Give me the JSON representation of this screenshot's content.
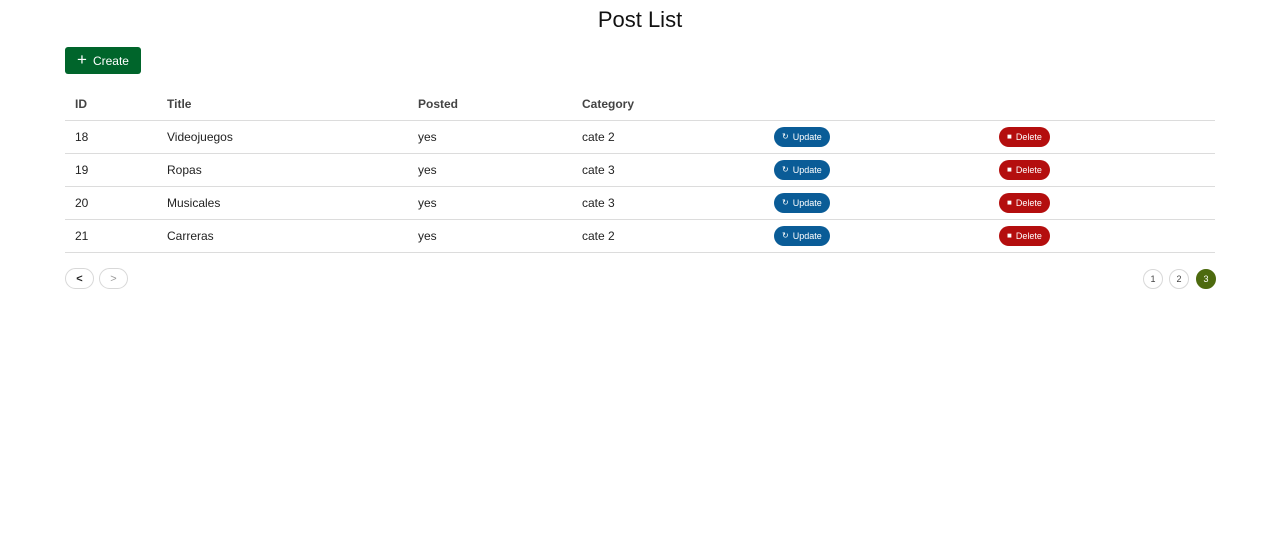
{
  "page": {
    "title": "Post List"
  },
  "toolbar": {
    "create_label": "Create",
    "create_icon": "plus-icon"
  },
  "table": {
    "headers": {
      "id": "ID",
      "title": "Title",
      "posted": "Posted",
      "category": "Category"
    },
    "rows": [
      {
        "id": "18",
        "title": "Videojuegos",
        "posted": "yes",
        "category": "cate 2",
        "update_label": "Update",
        "delete_label": "Delete"
      },
      {
        "id": "19",
        "title": "Ropas",
        "posted": "yes",
        "category": "cate 3",
        "update_label": "Update",
        "delete_label": "Delete"
      },
      {
        "id": "20",
        "title": "Musicales",
        "posted": "yes",
        "category": "cate 3",
        "update_label": "Update",
        "delete_label": "Delete"
      },
      {
        "id": "21",
        "title": "Carreras",
        "posted": "yes",
        "category": "cate 2",
        "update_label": "Update",
        "delete_label": "Delete"
      }
    ]
  },
  "pagination": {
    "pages": [
      "1",
      "2",
      "3"
    ],
    "current_page": "3",
    "prev_icon": "chevron-left-icon",
    "next_icon": "chevron-right-icon"
  },
  "colors": {
    "create": "#00652b",
    "update": "#0a5c97",
    "delete": "#b40e0e",
    "active_page": "#4d6a0e"
  }
}
